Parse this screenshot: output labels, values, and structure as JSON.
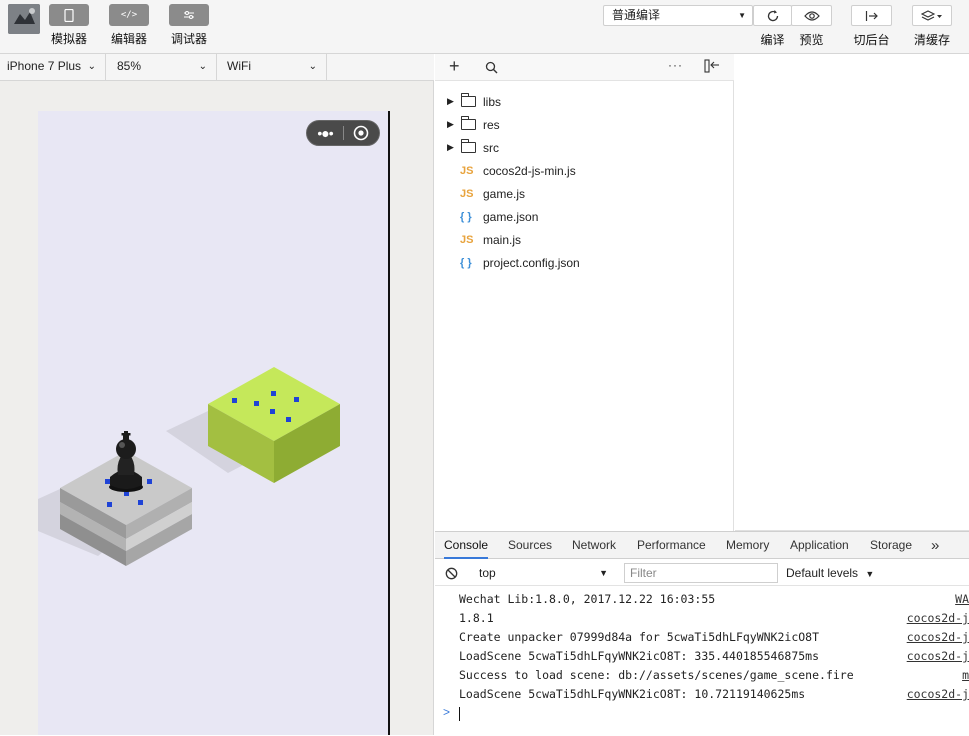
{
  "toolbar": {
    "simulator_label": "模拟器",
    "editor_label": "编辑器",
    "debugger_label": "调试器",
    "compile_mode": "普通编译",
    "compile_label": "编译",
    "preview_label": "预览",
    "background_label": "切后台",
    "clear_cache_label": "清缓存"
  },
  "device_bar": {
    "device": "iPhone 7 Plus",
    "zoom": "85%",
    "network": "WiFi"
  },
  "file_tree": {
    "items": [
      {
        "type": "folder",
        "name": "libs"
      },
      {
        "type": "folder",
        "name": "res"
      },
      {
        "type": "folder",
        "name": "src"
      },
      {
        "type": "js",
        "badge": "JS",
        "name": "cocos2d-js-min.js"
      },
      {
        "type": "js",
        "badge": "JS",
        "name": "game.js"
      },
      {
        "type": "json",
        "badge": "{ }",
        "name": "game.json"
      },
      {
        "type": "js",
        "badge": "JS",
        "name": "main.js"
      },
      {
        "type": "json",
        "badge": "{ }",
        "name": "project.config.json"
      }
    ]
  },
  "devtools": {
    "tabs": [
      "Console",
      "Sources",
      "Network",
      "Performance",
      "Memory",
      "Application",
      "Storage",
      "»"
    ],
    "active_tab": "Console",
    "context": "top",
    "filter_placeholder": "Filter",
    "levels": "Default levels",
    "logs": [
      {
        "text": "Wechat Lib:1.8.0, 2017.12.22 16:03:55",
        "source": "WA"
      },
      {
        "text": "1.8.1",
        "source": "cocos2d-j"
      },
      {
        "text": "Create unpacker 07999d84a for 5cwaTi5dhLFqyWNK2icO8T",
        "source": "cocos2d-j"
      },
      {
        "text": "LoadScene 5cwaTi5dhLFqyWNK2icO8T: 335.440185546875ms",
        "source": "cocos2d-j"
      },
      {
        "text": "Success to load scene: db://assets/scenes/game_scene.fire",
        "source": "m"
      },
      {
        "text": "LoadScene 5cwaTi5dhLFqyWNK2icO8T: 10.72119140625ms",
        "source": "cocos2d-j"
      }
    ],
    "prompt": ">"
  },
  "colors": {
    "accent": "#3879d9",
    "js_badge": "#e8a33d",
    "json_badge": "#3c8fd8",
    "green_block_top": "#c5e85a",
    "gray_block_top": "#c9c9c9"
  }
}
